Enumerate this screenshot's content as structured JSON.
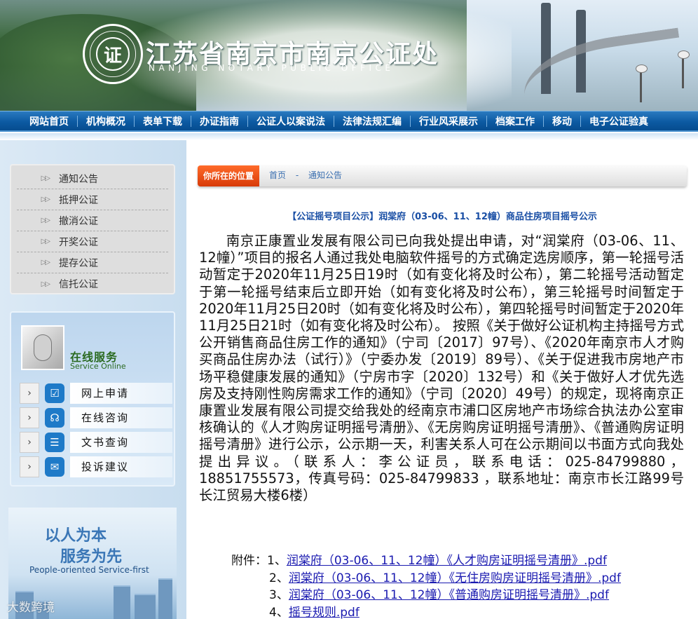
{
  "header": {
    "site_title": "江苏省南京市南京公证处",
    "site_subtitle": "NANJING NOTARY PUBLIC OFFICE",
    "seal_text": "NANJING NOTARY PUBLIC OFFICE",
    "seal_glyph": "证"
  },
  "nav": {
    "items": [
      "网站首页",
      "机构概况",
      "表单下载",
      "办证指南",
      "公证人以案说法",
      "法律法规汇编",
      "行业风采展示",
      "档案工作",
      "移动",
      "电子公证验真"
    ]
  },
  "sidebar": {
    "menu": [
      "通知公告",
      "抵押公证",
      "撤消公证",
      "开奖公证",
      "提存公证",
      "信托公证"
    ],
    "menu_arrow": "▷▷",
    "service": {
      "title_zh": "在线服务",
      "title_en": "Service Online",
      "items": [
        {
          "label": "网上申请",
          "icon": "checklist-icon",
          "glyph": "☑"
        },
        {
          "label": "在线咨询",
          "icon": "headset-icon",
          "glyph": "☊"
        },
        {
          "label": "文书查询",
          "icon": "document-list-icon",
          "glyph": "☰"
        },
        {
          "label": "投诉建议",
          "icon": "chat-bubble-icon",
          "glyph": "✉"
        }
      ],
      "chevron": "›"
    },
    "slogan": {
      "line1": "以人为本",
      "line2": "服务为先",
      "line3": "People-oriented  Service-first"
    }
  },
  "watermark": "大数跨境",
  "breadcrumb": {
    "tag": "你所在的位置",
    "home": "首页",
    "sep": "-",
    "current": "通知公告"
  },
  "article": {
    "title": "【公证摇号项目公示】润棠府（03-06、11、12幢）商品住房项目摇号公示",
    "body": "南京正康置业发展有限公司已向我处提出申请，对“润棠府（03-06、11、12幢）”项目的报名人通过我处电脑软件摇号的方式确定选房顺序，第一轮摇号活动暂定于2020年11月25日19时（如有变化将及时公布），第二轮摇号活动暂定于第一轮摇号结束后立即开始（如有变化将及时公布），第三轮摇号时间暂定于2020年11月25日20时（如有变化将及时公布），第四轮摇号时间暂定于2020年11月25日21时（如有变化将及时公布）。 按照《关于做好公证机构主持摇号方式公开销售商品住房工作的通知》（宁司〔2017〕97号）、《2020年南京市人才购买商品住房办法（试行）》（宁委办发〔2019〕89号）、《关于促进我市房地产市场平稳健康发展的通知》（宁房市字〔2020〕132号）和《关于做好人才优先选房及支持刚性购房需求工作的通知》（宁司〔2020〕49号）的规定，现将南京正康置业发展有限公司提交给我处的经南京市浦口区房地产市场综合执法办公室审核确认的《人才购房证明摇号清册》、《无房购房证明摇号清册》、《普通购房证明摇号清册》进行公示，公示期一天，利害关系人可在公示期间以书面方式向我处提出异议。（联系人：李公证员，联系电话：025-84799880，18851755573，传真号码：025-84799833 ，联系地址：南京市长江路99号长江贸易大楼6楼）",
    "attachments_label": "附件：",
    "attachments": [
      {
        "num": "1、",
        "text": "润棠府（03-06、11、12幢）《人才购房证明摇号清册》.pdf"
      },
      {
        "num": "2、",
        "text": "润棠府（03-06、11、12幢）《无住房购房证明摇号清册》.pdf"
      },
      {
        "num": "3、",
        "text": "润棠府（03-06、11、12幢）《普通购房证明摇号清册》.pdf"
      },
      {
        "num": "4、",
        "text": "摇号规则.pdf"
      }
    ]
  }
}
